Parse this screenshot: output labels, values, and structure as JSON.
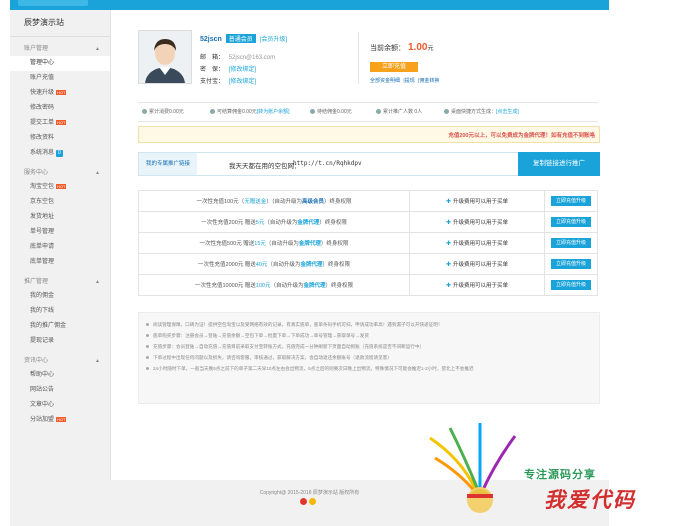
{
  "sidebar": {
    "site_name": "辰梦演示站",
    "groups": [
      {
        "title": "账户管理",
        "items": [
          {
            "label": "管理中心",
            "active": true
          },
          {
            "label": "账户充值"
          },
          {
            "label": "快速升级",
            "hot": "HOT"
          },
          {
            "label": "修改密码"
          },
          {
            "label": "提交工单",
            "hot": "HOT"
          },
          {
            "label": "修改资料"
          },
          {
            "label": "系统消息",
            "count": "0"
          }
        ]
      },
      {
        "title": "服务中心",
        "items": [
          {
            "label": "淘宝空包",
            "hot": "HOT"
          },
          {
            "label": "京东空包"
          },
          {
            "label": "发货地址"
          },
          {
            "label": "单号管理"
          },
          {
            "label": "底单申请"
          },
          {
            "label": "底单管理"
          }
        ]
      },
      {
        "title": "推广管理",
        "items": [
          {
            "label": "我的佣金"
          },
          {
            "label": "我的下线"
          },
          {
            "label": "我的推广佣金"
          },
          {
            "label": "提现记录"
          }
        ]
      },
      {
        "title": "资讯中心",
        "items": [
          {
            "label": "帮助中心"
          },
          {
            "label": "网站公告"
          },
          {
            "label": "文章中心"
          },
          {
            "label": "分站加盟",
            "hot": "HOT"
          }
        ]
      }
    ]
  },
  "profile": {
    "username": "52jscn",
    "level": "普通会员",
    "level_link": "[会员升级]",
    "email_label": "邮　箱：",
    "email": "52jscn@163.com",
    "password_label": "密　保：",
    "password_link": "[修改绑定]",
    "alipay_label": "支付宝：",
    "alipay_link": "[修改绑定]"
  },
  "balance": {
    "label": "当前余额：",
    "value": "1.00",
    "unit": "元",
    "recharge_button": "立即充值",
    "links": [
      "全部资金明细",
      "|提现",
      "|佣金转换"
    ]
  },
  "stats": [
    {
      "text": "累计消费0.00元",
      "icon": "coin-icon"
    },
    {
      "text": "可结算佣金0.00元",
      "link": "[转为账户余额]",
      "icon": "wallet-icon"
    },
    {
      "text": "待结佣金0.00元",
      "icon": "clock-icon"
    },
    {
      "text": "累计推广人数 0人",
      "icon": "people-icon"
    },
    {
      "text": "桌面快捷方式生成：",
      "link": "[点击生成]",
      "icon": "desktop-icon"
    }
  ],
  "notice": "充值200元以上，可以免费成为金牌代理！如有充值不到账咯",
  "promo_link": {
    "label": "我的专属推广链接",
    "prefix": "我天天都在用的空包网：",
    "url": "http://t.cn/Rqhkdpv",
    "copy_button": "复制链接进行推广"
  },
  "upgrades": [
    {
      "pre": "一次性充值100元（",
      "gift": "无赠送金",
      "mid": "）（自动升级为",
      "level": "高级会员",
      "post": "）终身权限",
      "level_style": "hl2"
    },
    {
      "pre": "一次性充值200元 赠送",
      "gift": "5元",
      "mid": "（自动升级为",
      "level": "金牌代理",
      "post": "）终身权限",
      "level_style": "hl3"
    },
    {
      "pre": "一次性充值500元 赠送",
      "gift": "15元",
      "mid": "（自动升级为",
      "level": "金牌代理",
      "post": "）终身权限",
      "level_style": "hl3"
    },
    {
      "pre": "一次性充值2000元 赠送",
      "gift": "40元",
      "mid": "（自动升级为",
      "level": "金牌代理",
      "post": "）终身权限",
      "level_style": "hl3"
    },
    {
      "pre": "一次性充值10000元 赠送",
      "gift": "100元",
      "mid": "（自动升级为",
      "level": "金牌代理",
      "post": "）终身权限",
      "level_style": "hl3"
    }
  ],
  "upgrade_note": "升级费用可以用于买单",
  "upgrade_button": "立即充值升级",
  "tips": [
    "阅读管理保障，口碑为证！提供空包淘宝以及受网络有效的记录，有真实底单，底单条码手机可扫，申请成功率高！遇到漏子可以开快递证明！",
    "底单购买步骤：注册会员→登陆→充值余额→空包下单→批量下单→下单成功→单号管理→获取单号→发货",
    "充值步骤：会员登陆→自动充值→充值目前采取支付宝转账方式，充值完成一分钟刷新下页面自动到账（充值系统是否不间断运行中）",
    "下单过程中出现任何问题以及损失，请咨询客服，审核通过，获取解决方案，会自动退还余额账号（退款流程请见客）",
    "24小时随时下单，一般当天晚5点之前下的单子第二天早10点左右会出物流，5点之后的则要次日晚上出物流，特殊情况下可能会推迟1-2小时，望北上不会推迟"
  ],
  "footer": {
    "copyright": "Copyright@ 2015-2018 辰梦演示站 版权所有"
  },
  "watermark": {
    "line1": "专注源码分享",
    "line2": "我爱代码"
  }
}
